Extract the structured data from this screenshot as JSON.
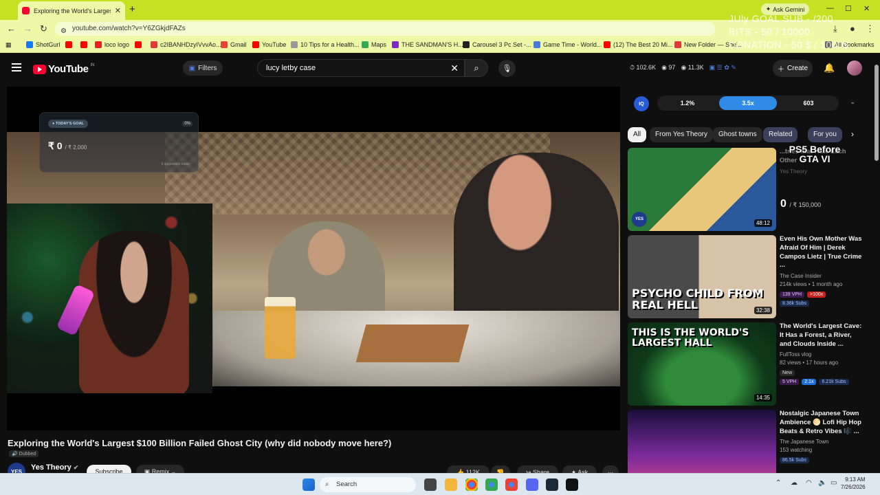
{
  "browser": {
    "tab_title": "Exploring the World's Largest $",
    "gemini_label": "Ask Gemini",
    "url": "youtube.com/watch?v=Y6ZGkjdFAZs",
    "bookmarks": [
      {
        "label": "ShotGurl",
        "color": "#1877f2"
      },
      {
        "label": "",
        "color": "#ff0000"
      },
      {
        "label": "",
        "color": "#ff0000"
      },
      {
        "label": "loco logo",
        "color": "#e52020"
      },
      {
        "label": "",
        "color": "#ff0000"
      },
      {
        "label": "c2IBANHDzyIVvvAo...",
        "color": "#e03a3a"
      },
      {
        "label": "Gmail",
        "color": "#ea4335"
      },
      {
        "label": "YouTube",
        "color": "#ff0000"
      },
      {
        "label": "10 Tips for a Health...",
        "color": "#999999"
      },
      {
        "label": "Maps",
        "color": "#34a853"
      },
      {
        "label": "THE SANDMAN'S H...",
        "color": "#7b2cbf"
      },
      {
        "label": "Carousel 3 Pc Set -...",
        "color": "#222222"
      },
      {
        "label": "Game Time - World...",
        "color": "#4a7bd8"
      },
      {
        "label": "(12) The Best 20 Mi...",
        "color": "#ff0000"
      },
      {
        "label": "New Folder — Shel...",
        "color": "#e03a3a"
      },
      {
        "label": "All Bookmarks",
        "color": "#666666"
      }
    ]
  },
  "stream_overlay": {
    "line1": "JUly GOAL  SUB - /200",
    "line2": "BITS - 50 / 10000",
    "line3": "DONATION - 50 $ / 1000$"
  },
  "youtube": {
    "logo_text": "YouTube",
    "logo_country": "IN",
    "filters_label": "Filters",
    "search_query": "lucy letby case",
    "stats": [
      "102.6K",
      "97",
      "11.3K"
    ],
    "create_label": "Create"
  },
  "goal_widget": {
    "pill": "TODAY'S GOAL",
    "pct": "0%",
    "amount": "0",
    "of": "/ ₹ 2,000",
    "sub": "0 supporters today"
  },
  "video": {
    "title": "Exploring the World's Largest $100 Billion Failed Ghost City (why did nobody move here?)",
    "dubbed": "Dubbed",
    "channel": "Yes Theory",
    "channel_initials": "YES",
    "subscribe_label": "Subscribe",
    "remix_label": "Remix",
    "likes": "112K",
    "share_label": "Share",
    "ask_label": "Ask"
  },
  "iq": {
    "logo": "IQ",
    "seg1": "1.2%",
    "seg2": "3.5x",
    "seg3": "603"
  },
  "chips": [
    "All",
    "From Yes Theory",
    "Ghost towns",
    "Related",
    "For you"
  ],
  "ps5_widget": {
    "title": "PS5 Before GTA VI",
    "amount": "0",
    "of": "/ ₹ 150,000"
  },
  "recommendations": [
    {
      "title": "...tries that Hate Each Other",
      "channel": "Yes Theory",
      "meta": "",
      "duration": "48:12",
      "caption": "",
      "colors": [
        "#2a7a3a",
        "#e9c77a",
        "#2b5a9c"
      ]
    },
    {
      "title": "Even His Own Mother Was Afraid Of Him | Derek Campos Lietz | True Crime ...",
      "channel": "The Case Insider",
      "meta": "214k views • 1 month ago",
      "duration": "32:38",
      "caption": "PSYCHO CHILD FROM REAL HELL",
      "badges": [
        "139 VPH",
        ">100x"
      ],
      "subs": "8.36k Subs",
      "colors": [
        "#4a4a4a",
        "#d8c2a8",
        "#1a1a1a"
      ]
    },
    {
      "title": "The World's Largest Cave: It Has a Forest, a River, and Clouds Inside ...",
      "channel": "FullToss vlog",
      "meta": "82 views • 17 hours ago",
      "duration": "14:35",
      "caption": "THIS IS THE WORLD'S LARGEST HALL",
      "badges": [
        "New",
        "5 VPH",
        "2.1x"
      ],
      "subs": "6.21k Subs",
      "colors": [
        "#0f3a1a",
        "#2f8a3a",
        "#0b2a12"
      ]
    },
    {
      "title": "Nostalgic Japanese Town Ambience 🌕 Lofi Hip Hop Beats & Retro Vibes 🎼 ...",
      "channel": "The Japanese Town",
      "meta": "153 watching",
      "duration": "",
      "caption": "",
      "subs": "86.5k Subs",
      "colors": [
        "#1a0f3a",
        "#7a2a9a",
        "#d84a8a"
      ]
    }
  ],
  "taskbar": {
    "search_label": "Search",
    "time": "9:13 AM",
    "date": "7/26/2026"
  }
}
